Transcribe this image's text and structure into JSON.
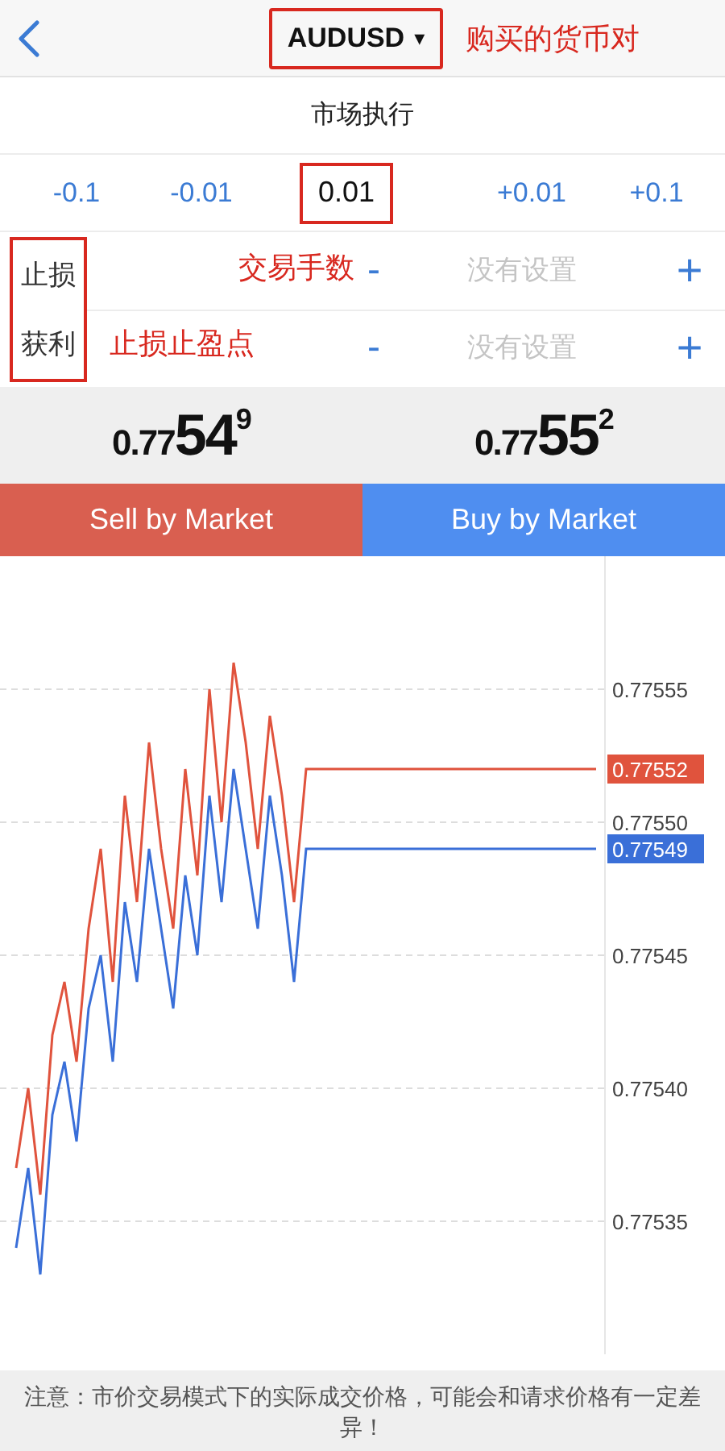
{
  "header": {
    "symbol": "AUDUSD",
    "caret": "▾",
    "symbol_boxed": true,
    "annotation": "购买的货币对"
  },
  "mode": "市场执行",
  "lots": {
    "annotation": "交易手数",
    "steps": [
      {
        "label": "-0.1",
        "kind": "step"
      },
      {
        "label": "-0.01",
        "kind": "step"
      },
      {
        "label": "0.01",
        "kind": "value",
        "boxed": true
      },
      {
        "label": "+0.01",
        "kind": "step"
      },
      {
        "label": "+0.1",
        "kind": "step"
      }
    ]
  },
  "orders": {
    "labels_boxed": true,
    "annotation": "止损止盈点",
    "rows": [
      {
        "label": "止损",
        "minus": "-",
        "placeholder": "没有设置",
        "plus": "+"
      },
      {
        "label": "获利",
        "minus": "-",
        "placeholder": "没有设置",
        "plus": "+"
      }
    ]
  },
  "prices": [
    {
      "prefix": "0.77",
      "big": "54",
      "pip": "9"
    },
    {
      "prefix": "0.77",
      "big": "55",
      "pip": "2"
    }
  ],
  "buttons": [
    {
      "label": "Sell by Market",
      "kind": "sell"
    },
    {
      "label": "Buy by Market",
      "kind": "buy"
    }
  ],
  "chart": {
    "last_prices": [
      {
        "label": "0.77552"
      },
      {
        "label": "0.77549"
      }
    ],
    "chart_data": {
      "type": "line",
      "categories": [
        null,
        null,
        null,
        null,
        null,
        null,
        null,
        null,
        null,
        null,
        null,
        null,
        null,
        null,
        null,
        null,
        null,
        null,
        null,
        null,
        null,
        null,
        null,
        null,
        null,
        null,
        null,
        null,
        null,
        null,
        null,
        null,
        null,
        null,
        null,
        null,
        null,
        null,
        null,
        null,
        null,
        null,
        null,
        null,
        null,
        null,
        null,
        null,
        null
      ],
      "grid": true,
      "ylim": [
        0.7753,
        0.7756
      ],
      "yticks": [
        {
          "value": 0.77555,
          "label": "0.77555"
        },
        {
          "value": 0.7755,
          "label": "0.77550"
        },
        {
          "value": 0.77545,
          "label": "0.77545"
        },
        {
          "value": 0.7754,
          "label": "0.77540"
        },
        {
          "value": 0.77535,
          "label": "0.77535"
        }
      ],
      "series": [
        {
          "color": "#e0533d",
          "values": [
            0.77537,
            0.7754,
            0.77536,
            0.77542,
            0.77544,
            0.77541,
            0.77546,
            0.77549,
            0.77544,
            0.77551,
            0.77547,
            0.77553,
            0.77549,
            0.77546,
            0.77552,
            0.77548,
            0.77555,
            0.7755,
            0.77556,
            0.77553,
            0.77549,
            0.77554,
            0.77551,
            0.77547,
            0.77552,
            0.77552,
            0.77552,
            0.77552,
            0.77552,
            0.77552,
            0.77552,
            0.77552,
            0.77552,
            0.77552,
            0.77552,
            0.77552,
            0.77552,
            0.77552,
            0.77552,
            0.77552,
            0.77552,
            0.77552,
            0.77552,
            0.77552,
            0.77552,
            0.77552,
            0.77552,
            0.77552,
            0.77552
          ]
        },
        {
          "color": "#3a6fd8",
          "values": [
            0.77534,
            0.77537,
            0.77533,
            0.77539,
            0.77541,
            0.77538,
            0.77543,
            0.77545,
            0.77541,
            0.77547,
            0.77544,
            0.77549,
            0.77546,
            0.77543,
            0.77548,
            0.77545,
            0.77551,
            0.77547,
            0.77552,
            0.77549,
            0.77546,
            0.77551,
            0.77548,
            0.77544,
            0.77549,
            0.77549,
            0.77549,
            0.77549,
            0.77549,
            0.77549,
            0.77549,
            0.77549,
            0.77549,
            0.77549,
            0.77549,
            0.77549,
            0.77549,
            0.77549,
            0.77549,
            0.77549,
            0.77549,
            0.77549,
            0.77549,
            0.77549,
            0.77549,
            0.77549,
            0.77549,
            0.77549,
            0.77549
          ]
        }
      ]
    }
  },
  "note": "注意：市价交易模式下的实际成交价格，可能会和请求价格有一定差异！"
}
